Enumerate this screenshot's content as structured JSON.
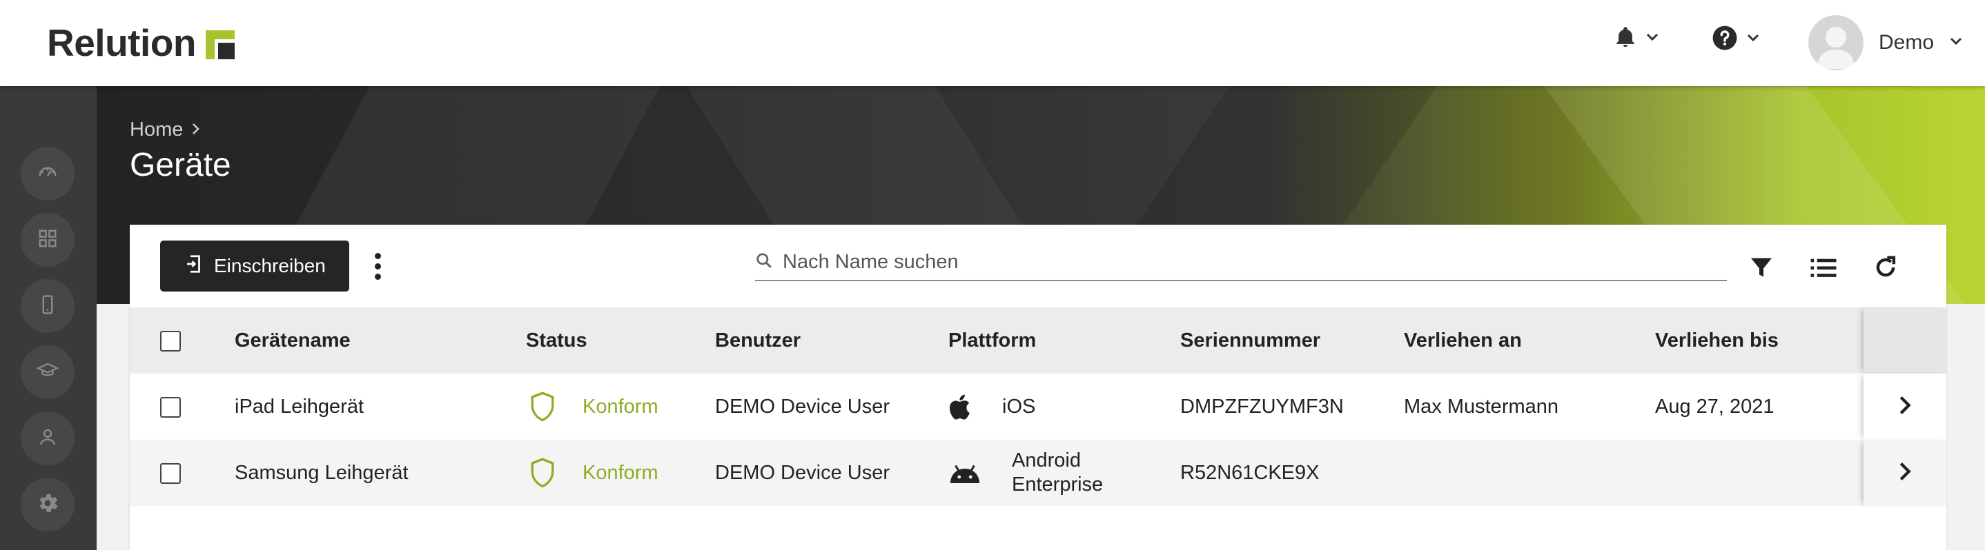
{
  "app": {
    "logo_text": "Relution"
  },
  "header": {
    "user_name": "Demo"
  },
  "breadcrumb": {
    "home": "Home"
  },
  "page": {
    "title": "Geräte"
  },
  "toolbar": {
    "enroll_label": "Einschreiben",
    "search_placeholder": "Nach Name suchen"
  },
  "table": {
    "columns": [
      "Gerätename",
      "Status",
      "Benutzer",
      "Plattform",
      "Seriennummer",
      "Verliehen an",
      "Verliehen bis"
    ],
    "rows": [
      {
        "name": "iPad Leihgerät",
        "status": "Konform",
        "user": "DEMO Device User",
        "platform": "iOS",
        "platform_icon": "apple-icon",
        "serial": "DMPZFZUYMF3N",
        "lent_to": "Max Mustermann",
        "lent_until": "Aug 27, 2021"
      },
      {
        "name": "Samsung Leihgerät",
        "status": "Konform",
        "user": "DEMO Device User",
        "platform_line1": "Android",
        "platform_line2": "Enterprise",
        "platform_icon": "android-icon",
        "serial": "R52N61CKE9X",
        "lent_to": "",
        "lent_until": ""
      }
    ]
  },
  "colors": {
    "accent": "#8cad24",
    "brand_green": "#a7c42c",
    "dark": "#252525"
  }
}
